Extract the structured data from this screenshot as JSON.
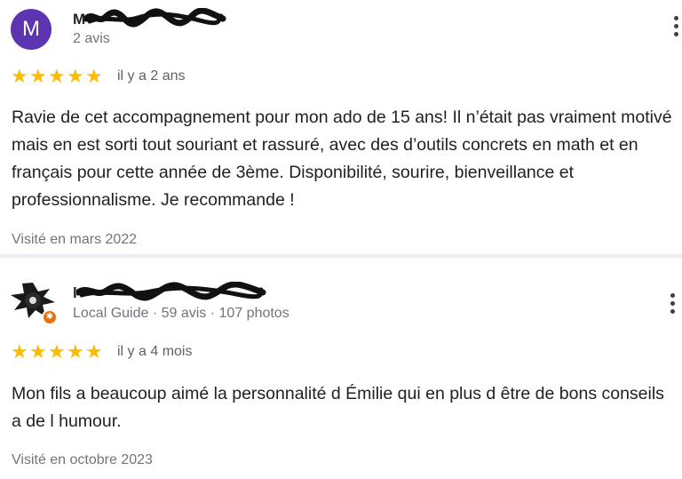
{
  "reviews": [
    {
      "avatar_letter": "M",
      "author_name": "M",
      "meta": "2 avis",
      "rating": 5,
      "age": "il y a 2 ans",
      "text": "Ravie de cet accompagnement pour mon ado de 15 ans! Il n’était pas vraiment motivé mais en est sorti tout souriant et rassuré, avec des d’outils concrets en math et en français pour cette année de 3ème. Disponibilité, sourire, bienveillance et professionnalisme. Je recommande !",
      "visit": "Visité en mars 2022"
    },
    {
      "author_name": "l",
      "meta": "Local Guide · 59 avis · 107 photos",
      "rating": 5,
      "age": "il y a 4 mois",
      "text": "Mon fils a beaucoup aimé la personnalité d Émilie qui en plus d être de bons conseils a de l humour.",
      "visit": "Visité en octobre 2023"
    }
  ],
  "colors": {
    "star": "#fbbc04",
    "avatar_bg": "#5e35b1",
    "local_guide_badge": "#e8710a",
    "divider": "#e8eef4"
  },
  "icons": {
    "star": "star-icon",
    "menu": "more-vertical-icon",
    "badge": "local-guide-badge-icon"
  }
}
